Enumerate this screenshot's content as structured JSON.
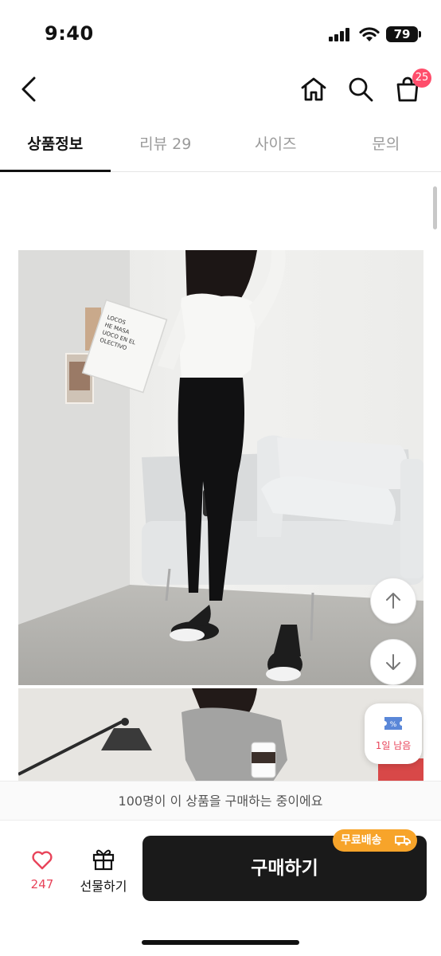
{
  "status_bar": {
    "time": "9:40",
    "battery": "79"
  },
  "header": {
    "cart_count": "25"
  },
  "tabs": [
    {
      "label": "상품정보",
      "active": true
    },
    {
      "label": "리뷰 29",
      "active": false
    },
    {
      "label": "사이즈",
      "active": false
    },
    {
      "label": "문의",
      "active": false
    }
  ],
  "photo1": {
    "book_text": [
      "LOCOS",
      "HE MASA",
      "UOCO EN EL",
      "OLECTIVO"
    ]
  },
  "coupon": {
    "label": "1일 남음"
  },
  "notice": {
    "text": "100명이 이 상품을 구매하는 중이에요"
  },
  "bottom": {
    "like_count": "247",
    "gift_label": "선물하기",
    "buy_label": "구매하기",
    "free_shipping": "무료배송"
  },
  "colors": {
    "accent_pink": "#e8445a",
    "badge": "#ff4d6b",
    "shipping": "#f7a42a",
    "buy_bg": "#1a1a1a"
  }
}
